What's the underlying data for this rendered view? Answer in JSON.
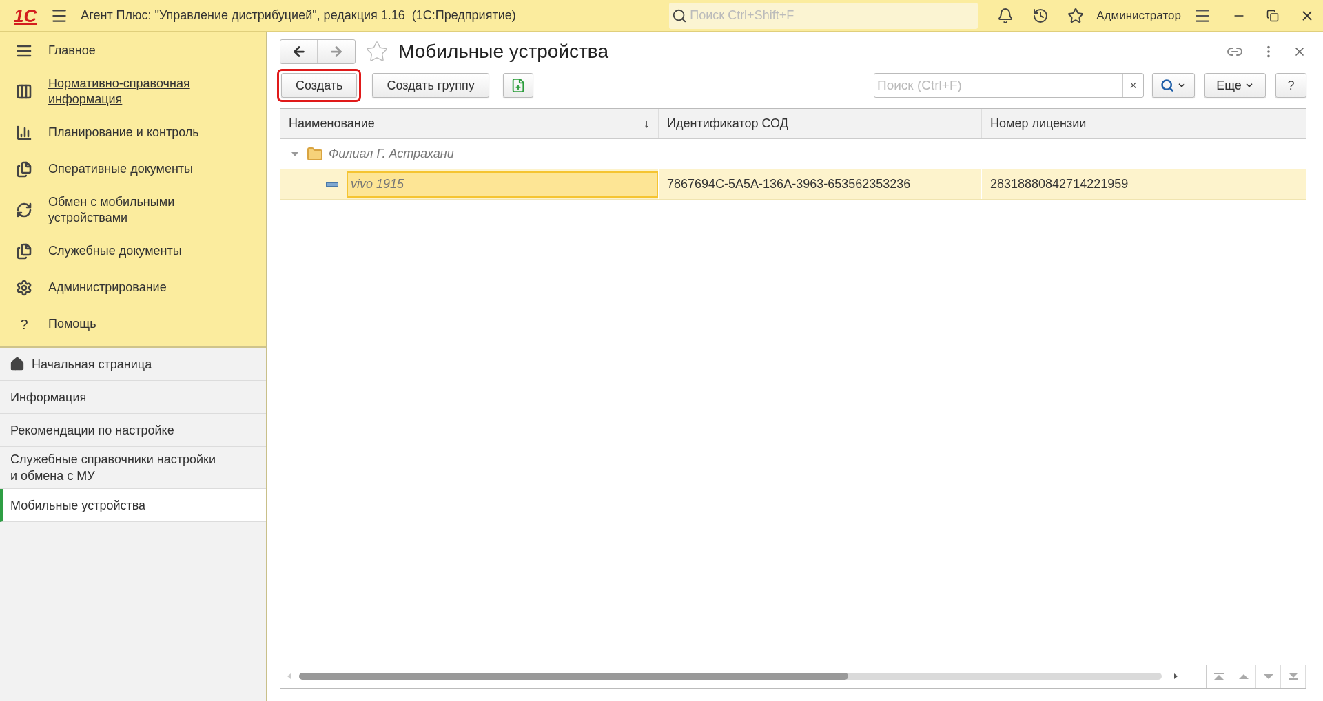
{
  "title_bar": {
    "logo": "1С",
    "title": "Агент Плюс: \"Управление дистрибуцией\", редакция 1.16  (1С:Предприятие)",
    "search": {
      "placeholder": "Поиск Ctrl+Shift+F"
    },
    "user": "Администратор"
  },
  "sections": [
    {
      "label": "Главное",
      "hovered": false
    },
    {
      "label": "Нормативно-справочная информация",
      "hovered": true
    },
    {
      "label": "Планирование и контроль",
      "hovered": false
    },
    {
      "label": "Оперативные документы",
      "hovered": false
    },
    {
      "label": "Обмен с мобильными устройствами",
      "hovered": false
    },
    {
      "label": "Служебные документы",
      "hovered": false
    },
    {
      "label": "Администрирование",
      "hovered": false
    },
    {
      "label": "Помощь",
      "hovered": false
    }
  ],
  "help_glyph": "?",
  "open_pages": [
    {
      "label": "Начальная страница",
      "kind": "home",
      "selected": false
    },
    {
      "label": "Информация",
      "kind": "page",
      "selected": false
    },
    {
      "label": "Рекомендации по настройке",
      "kind": "page",
      "selected": false
    },
    {
      "label": "Служебные справочники настройки и обмена с МУ",
      "kind": "page",
      "selected": false
    },
    {
      "label": "Мобильные устройства",
      "kind": "page",
      "selected": true
    }
  ],
  "form": {
    "title": "Мобильные устройства",
    "favorite": false,
    "buttons": [
      {
        "label": "Создать",
        "highlighted": true
      },
      {
        "label": "Создать группу",
        "highlighted": false
      }
    ],
    "search": {
      "placeholder": "Поиск (Ctrl+F)",
      "clear": "×"
    },
    "more": "Еще",
    "help": "?"
  },
  "table": {
    "columns": [
      {
        "label": "Наименование",
        "sort": "↓"
      },
      {
        "label": "Идентификатор СОД"
      },
      {
        "label": "Номер лицензии"
      }
    ],
    "rows": [
      {
        "kind": "group",
        "name": "Филиал Г. Астрахани",
        "expanded": true,
        "selected": false,
        "children": [
          {
            "kind": "item",
            "name": "vivo 1915",
            "id": "7867694C-5A5A-136A-3963-653562353236",
            "license": "28318880842714221959",
            "selected": true
          }
        ]
      }
    ]
  }
}
